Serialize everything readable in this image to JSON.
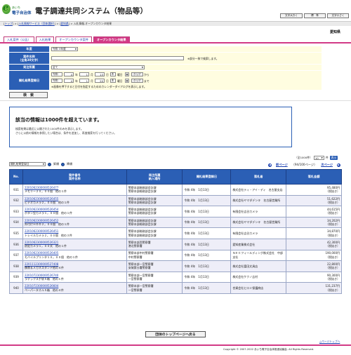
{
  "header": {
    "logo_small": "あいち",
    "logo_big": "電子自治体",
    "logo_letter": "e",
    "system_title": "電子調達共同システム（物品等）",
    "font_buttons": [
      "文字大きく",
      "標　準",
      "文字小さく"
    ]
  },
  "breadcrumb": {
    "items": [
      "トップ",
      "入札情報サービス（団体選択）",
      "愛知県",
      "入札情報-オープンカウンタ結果"
    ],
    "separator": " > "
  },
  "org_name": "愛知県",
  "tabs": [
    {
      "label": "入札案件（公告）",
      "active": false
    },
    {
      "label": "入札結果",
      "active": false
    },
    {
      "label": "オープンカウンタ案件",
      "active": false
    },
    {
      "label": "オープンカウンタ結果",
      "active": true
    }
  ],
  "form": {
    "year_label": "年度",
    "year_value": "令和 3年度",
    "name_label": "案件名称",
    "name_sub": "（全角30文字）",
    "name_hint": "※部分一致で検索します。",
    "section_label": "発注所属",
    "section_value": "全て",
    "date_label": "開札結果登録日",
    "from": {
      "era": "令和",
      "year": "4",
      "month": "1",
      "day": "13",
      "weekday": "木"
    },
    "to": {
      "era": "令和",
      "year": "4",
      "month": "1",
      "day": "20",
      "weekday": "木"
    },
    "unit_year": "年",
    "unit_month": "月",
    "unit_day": "日",
    "weekday_suffix": "曜日",
    "clear_label": "クリア",
    "from_suffix": "から",
    "to_suffix": "まで",
    "date_hint": "※画像を押下すると日付を指定するためのカレンダーダイアログを表示します。",
    "search_button": "検　索"
  },
  "message": {
    "title": "該当の情報は1000件を超えています。",
    "line1": "検索結果は最近に公開された1000件のみを表示します。",
    "line2": "さらに以前の情報を参照したい場合は、条件を追加し、再度検索を行ってください。"
  },
  "results": {
    "count_text": "（全1000件）",
    "per_page": "10",
    "per_page_unit": "件",
    "go": "表示",
    "sort_field": "開札結果登録日",
    "sort_asc": "昇順",
    "sort_desc": "降順",
    "prev": "前ページ",
    "page_info": "（94/100ページ）",
    "next": "次ページ",
    "headers": {
      "no": "No.",
      "item1": "案件番号",
      "item2": "案件名称",
      "sec1": "発注所属",
      "sec2": "納入場所",
      "date": "開札結果登録日",
      "company": "落札者",
      "amount": "落札金額"
    },
    "rows": [
      {
        "no": "931",
        "id": "2201062300000526477",
        "name": "メモリー２０，００個　他の１件",
        "sec": "警察本部総務部会計課",
        "place": "警察本部総務部会計課",
        "date": "令和 4年　1月13日",
        "company": "株式会社ティ・アイ・ディ　名古屋支店",
        "amount": "95,480円",
        "tax": "（税抜き）"
      },
      {
        "no": "932",
        "id": "2201062300000526455",
        "name": "ビデオカメラ２，００個　他の１件",
        "sec": "警察本部総務部会計課",
        "place": "警察本部総務部会計課",
        "date": "令和 4年　1月13日",
        "company": "株式会社ヤマダデンキ　名古屋営業所",
        "amount": "51,622円",
        "tax": "（税抜き）"
      },
      {
        "no": "933",
        "id": "2201062300000526454",
        "name": "ボタン型カメラ１，００個　他の１件",
        "sec": "警察本部総務部会計課",
        "place": "警察本部総務部会計課",
        "date": "令和 4年　1月13日",
        "company": "有限会社吉谷カメラ",
        "amount": "44,615円",
        "tax": "（税抜き）"
      },
      {
        "no": "934",
        "id": "2201062300000526452",
        "name": "外付けＨＤＤ２，００個　他の１件",
        "sec": "警察本部総務部会計課",
        "place": "警察本部総務部会計課",
        "date": "令和 4年　1月13日",
        "company": "株式会社ヤマダデンキ　名古屋営業所",
        "amount": "34,202円",
        "tax": "（税抜き）"
      },
      {
        "no": "935",
        "id": "2201062300000526451",
        "name": "トレイルカメラ２，００個　他の３件",
        "sec": "警察本部総務部会計課",
        "place": "警察本部総務部会計課",
        "date": "令和 4年　1月13日",
        "company": "有限会社吉谷カメラ",
        "amount": "34,870円",
        "tax": "（税抜き）"
      },
      {
        "no": "936",
        "id": "2201062300000526321",
        "name": "防犯カメラ１，００式　他の１件",
        "sec": "警察本部西警察署",
        "place": "港北警察署",
        "date": "令和 4年　1月13日",
        "company": "愛知産業株式会社",
        "amount": "42,300円",
        "tax": "（税抜き）"
      },
      {
        "no": "937",
        "id": "2201062300000526405",
        "name": "モバイルプリンタ１０，００個　他の１件",
        "sec": "警察本部中村警察署",
        "place": "中村警察署",
        "date": "令和 4年　1月13日",
        "company": "ＮＥＣフィールディング株式会社　中部支社",
        "amount": "190,000円",
        "tax": "（税抜き）"
      },
      {
        "no": "938",
        "id": "2201112300000527408",
        "name": "携帯＆メガネスタンド他の４件",
        "sec": "警察本部一宮警察署",
        "place": "安城第分署警察署",
        "date": "令和 4年　1月13日",
        "company": "株式会社富田文具店",
        "amount": "22,800円",
        "tax": "（税抜き）"
      },
      {
        "no": "939",
        "id": "2201072300000526740",
        "name": "ラテックス手袋５箱　他の１件",
        "sec": "警察本部一宮警察署",
        "place": "一宮警察署",
        "date": "令和 4年　1月13日",
        "company": "株式会社ケクノ吉村",
        "amount": "90,300円",
        "tax": "（税抜き）"
      },
      {
        "no": "940",
        "id": "2201072300000526604",
        "name": "ペーパータオル５箱　他の４件",
        "sec": "警察本部一宮警察署",
        "place": "一宮警察署",
        "date": "令和 4年　1月13日",
        "company": "合資会社ヒロミ保護商店",
        "amount": "131,237円",
        "tax": "（税抜き）"
      }
    ]
  },
  "top_button": "団体のトップページへ戻る",
  "page_top": "△ページトップへ",
  "copyright": "Copyright © 2007-2022 あいち電子自治体推進協議会. All Rights Reserved."
}
